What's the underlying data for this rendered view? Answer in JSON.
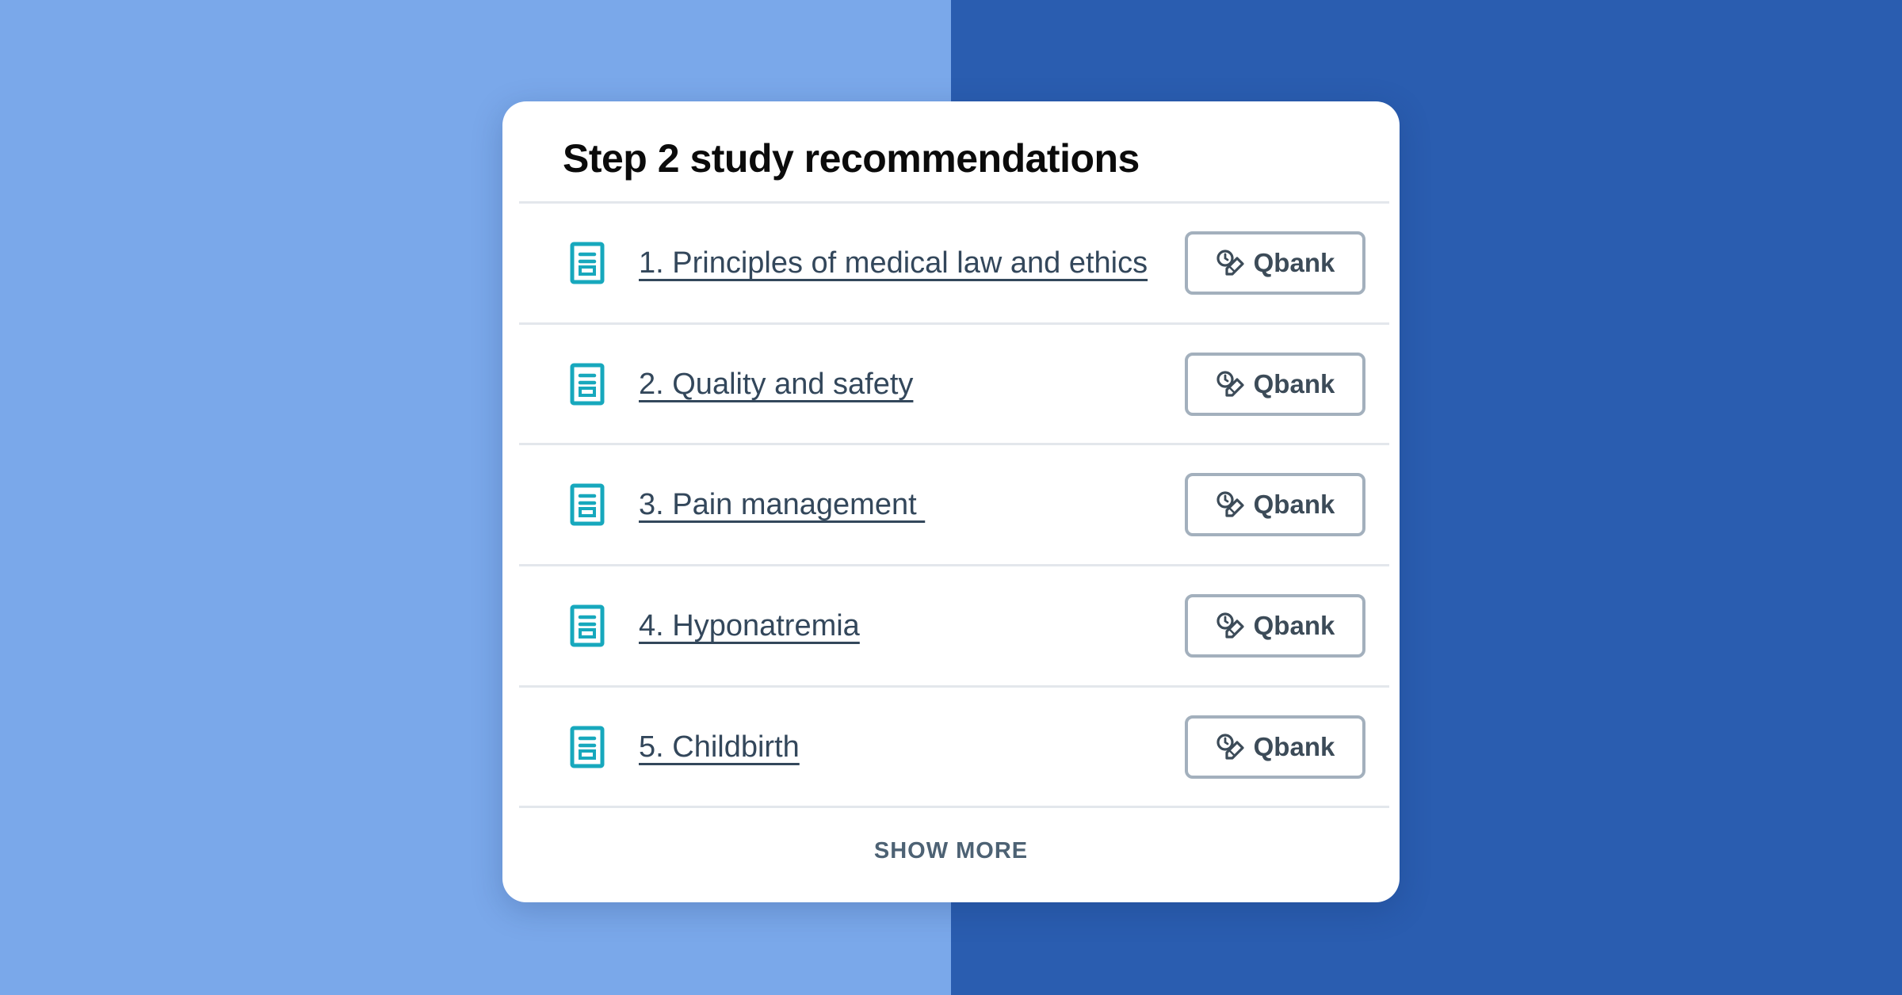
{
  "background": {
    "left_color": "#7aa8ea",
    "right_color": "#2a5db0"
  },
  "card": {
    "title": "Step 2 study recommendations",
    "accent_color": "#17a8bd",
    "items": [
      {
        "label": "1. Principles of medical law and ethics",
        "icon": "document-icon",
        "button_label": "Qbank",
        "button_icon": "clock-pencil-icon"
      },
      {
        "label": "2. Quality and safety",
        "icon": "document-icon",
        "button_label": "Qbank",
        "button_icon": "clock-pencil-icon"
      },
      {
        "label": "3. Pain management ",
        "icon": "document-icon",
        "button_label": "Qbank",
        "button_icon": "clock-pencil-icon"
      },
      {
        "label": "4. Hyponatremia",
        "icon": "document-icon",
        "button_label": "Qbank",
        "button_icon": "clock-pencil-icon"
      },
      {
        "label": "5. Childbirth",
        "icon": "document-icon",
        "button_label": "Qbank",
        "button_icon": "clock-pencil-icon"
      }
    ],
    "show_more_label": "SHOW MORE"
  }
}
